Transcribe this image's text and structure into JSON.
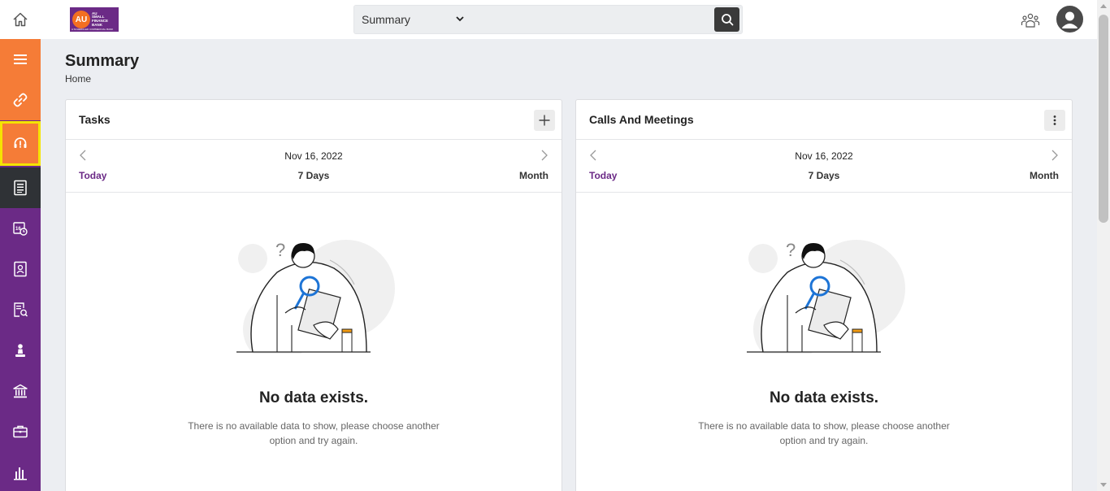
{
  "topbar": {
    "logo_text": "AU",
    "logo_lines": [
      "AU",
      "SMALL",
      "FINANCE",
      "BANK"
    ],
    "logo_subtitle": "A SCHEDULED COMMERCIAL BANK",
    "search": {
      "selected_option": "Summary",
      "placeholder": "",
      "value": ""
    },
    "icons": {
      "home": "home-icon",
      "search": "search-icon",
      "team": "team-icon",
      "avatar": "user-avatar-icon"
    }
  },
  "sidebar": {
    "items": [
      {
        "icon": "menu-icon",
        "state": "orange"
      },
      {
        "icon": "link-icon",
        "state": "orange"
      },
      {
        "icon": "support-icon",
        "state": "orange-highlighted"
      },
      {
        "icon": "document-list-icon",
        "state": "active-dark"
      },
      {
        "icon": "calendar-icon",
        "state": "normal"
      },
      {
        "icon": "contact-card-icon",
        "state": "normal"
      },
      {
        "icon": "document-search-icon",
        "state": "normal"
      },
      {
        "icon": "person-icon",
        "state": "normal"
      },
      {
        "icon": "bank-icon",
        "state": "normal"
      },
      {
        "icon": "briefcase-icon",
        "state": "normal"
      },
      {
        "icon": "bar-chart-icon",
        "state": "normal"
      }
    ]
  },
  "page": {
    "title": "Summary",
    "breadcrumb": "Home"
  },
  "cards": [
    {
      "title": "Tasks",
      "action_icon": "plus-icon",
      "date": "Nov 16, 2022",
      "today": "Today",
      "week": "7 Days",
      "month": "Month",
      "empty_title": "No data exists.",
      "empty_message": "There is no available data to show, please choose another option and try again."
    },
    {
      "title": "Calls And Meetings",
      "action_icon": "more-vertical-icon",
      "date": "Nov 16, 2022",
      "today": "Today",
      "week": "7 Days",
      "month": "Month",
      "empty_title": "No data exists.",
      "empty_message": "There is no available data to show, please choose another option and try again."
    }
  ],
  "colors": {
    "brand_purple": "#6b2a86",
    "brand_orange": "#f57c37",
    "highlight": "#f5e400",
    "dark": "#2f3236"
  }
}
